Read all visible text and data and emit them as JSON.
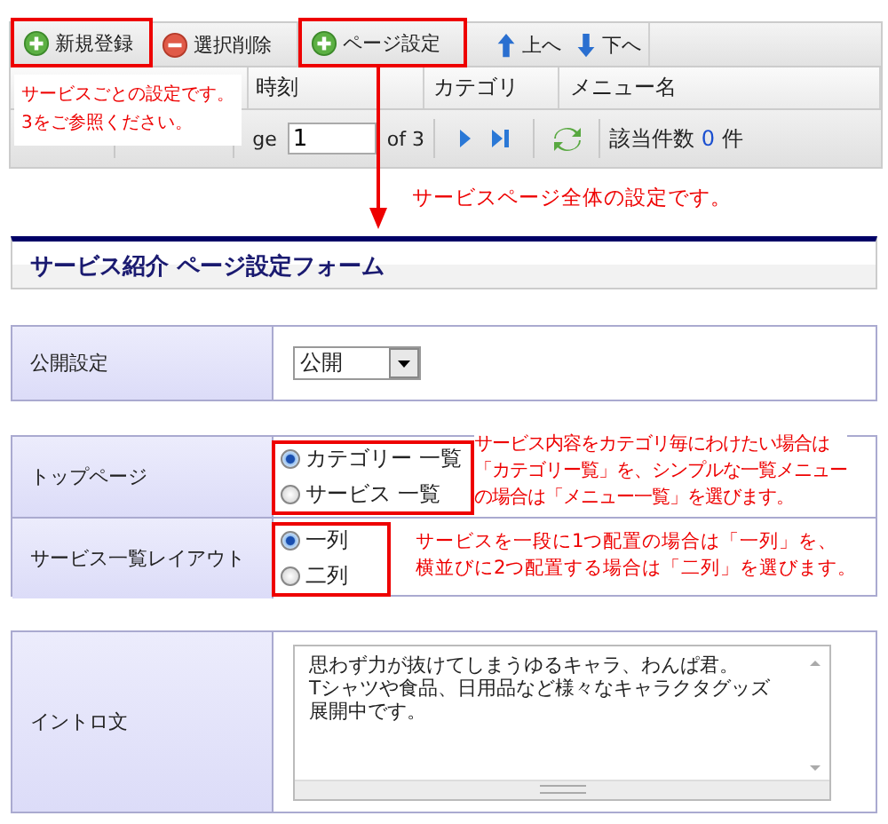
{
  "toolbar": {
    "buttons": [
      {
        "label": "新規登録",
        "kind": "add",
        "highlighted": true
      },
      {
        "label": "選択削除",
        "kind": "delete",
        "highlighted": false
      },
      {
        "label": "ページ設定",
        "kind": "add",
        "highlighted": true
      },
      {
        "label": "上へ",
        "kind": "up",
        "highlighted": false
      },
      {
        "label": "下へ",
        "kind": "down",
        "highlighted": false
      }
    ]
  },
  "grid": {
    "columns": [
      "時刻",
      "カテゴリ",
      "メニュー名"
    ]
  },
  "pager": {
    "page_label": "ge",
    "page": "1",
    "of": "of 3",
    "count_label": "該当件数",
    "count": "0",
    "unit": "件"
  },
  "notes": {
    "per_service": [
      "サービスごとの設定です。",
      "3をご参照ください。"
    ],
    "page_wide": "サービスページ全体の設定です。"
  },
  "form": {
    "title": "サービス紹介 ページ設定フォーム",
    "publish": {
      "label": "公開設定",
      "value": "公開"
    },
    "radio_rows": [
      {
        "label": "トップページ",
        "options": [
          {
            "label": "カテゴリー 一覧",
            "selected": true
          },
          {
            "label": "サービス 一覧",
            "selected": false
          }
        ],
        "note": [
          "サービス内容をカテゴリ毎にわけたい場合は",
          "「カテゴリー覧」を、シンプルな一覧メニュー",
          "の場合は「メニュー一覧」を選びます。"
        ]
      },
      {
        "label": "サービス一覧レイアウト",
        "options": [
          {
            "label": "一列",
            "selected": true
          },
          {
            "label": "二列",
            "selected": false
          }
        ],
        "note": [
          "サービスを一段に1つ配置の場合は「一列」を、",
          "横並びに2つ配置する場合は「二列」を選びます。"
        ]
      }
    ],
    "intro": {
      "label": "イントロ文",
      "value_lines": [
        "思わず力が抜けてしまうゆるキャラ、わんぱ君。",
        "Tシャツや食品、日用品など様々なキャラクタグッズ",
        "展開中です。"
      ]
    }
  }
}
